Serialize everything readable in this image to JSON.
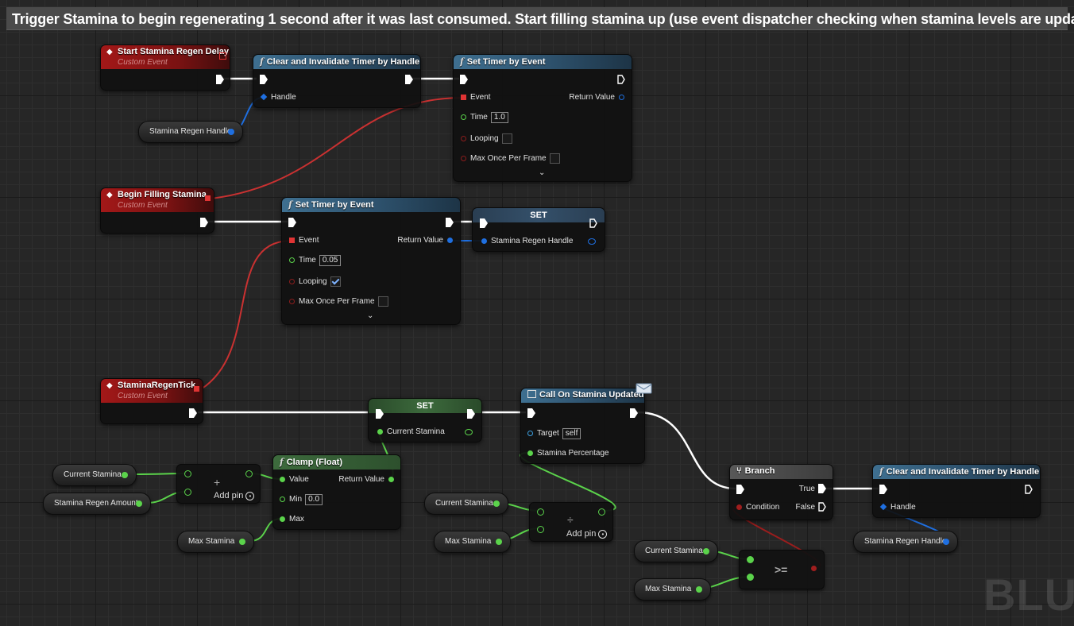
{
  "comment": {
    "title": "Trigger Stamina to begin regenerating 1 second after it was last consumed. Start filling stamina up (use event dispatcher checking when stamina levels are updated)"
  },
  "colors": {
    "exec": "#ffffff",
    "float": "#5bd34b",
    "struct": "#1f6fe0",
    "delegate": "#e03434",
    "bool": "#8b1d1d",
    "event_header": "#a31818",
    "function_header": "#3e6f90"
  },
  "events": {
    "regen_delay": {
      "title": "Start Stamina Regen Delay",
      "subtitle": "Custom Event"
    },
    "begin_filling": {
      "title": "Begin Filling Stamina",
      "subtitle": "Custom Event"
    },
    "regen_tick": {
      "title": "StaminaRegenTick",
      "subtitle": "Custom Event"
    }
  },
  "clear_timer_1": {
    "title": "Clear and Invalidate Timer by Handle",
    "handle_label": "Handle"
  },
  "set_timer_1": {
    "title": "Set Timer by Event",
    "event_label": "Event",
    "return_label": "Return Value",
    "time_label": "Time",
    "time_value": "1.0",
    "looping_label": "Looping",
    "looping_checked": false,
    "max_once_label": "Max Once Per Frame",
    "max_once_checked": false
  },
  "set_timer_2": {
    "title": "Set Timer by Event",
    "event_label": "Event",
    "return_label": "Return Value",
    "time_label": "Time",
    "time_value": "0.05",
    "looping_label": "Looping",
    "looping_checked": true,
    "max_once_label": "Max Once Per Frame",
    "max_once_checked": false
  },
  "set_handle": {
    "title": "SET",
    "pin_label": "Stamina Regen Handle"
  },
  "var_regen_handle_1": {
    "label": "Stamina Regen Handle"
  },
  "set_stamina": {
    "title": "SET",
    "pin_label": "Current Stamina"
  },
  "call_updated": {
    "title": "Call On Stamina Updated",
    "target_label": "Target",
    "target_value": "self",
    "pct_label": "Stamina Percentage"
  },
  "var_current_1": {
    "label": "Current Stamina"
  },
  "var_regen_amount": {
    "label": "Stamina Regen Amount"
  },
  "add_node": {
    "symbol": "+",
    "addpin_label": "Add pin"
  },
  "clamp": {
    "title": "Clamp (Float)",
    "value_label": "Value",
    "return_label": "Return Value",
    "min_label": "Min",
    "min_value": "0.0",
    "max_label": "Max"
  },
  "var_max_1": {
    "label": "Max Stamina"
  },
  "var_current_2": {
    "label": "Current Stamina"
  },
  "var_max_2": {
    "label": "Max Stamina"
  },
  "div_node": {
    "symbol": "÷",
    "addpin_label": "Add pin"
  },
  "branch": {
    "title": "Branch",
    "true_label": "True",
    "false_label": "False",
    "cond_label": "Condition"
  },
  "clear_timer_2": {
    "title": "Clear and Invalidate Timer by Handle",
    "handle_label": "Handle"
  },
  "var_regen_handle_2": {
    "label": "Stamina Regen Handle"
  },
  "var_current_3": {
    "label": "Current Stamina"
  },
  "var_max_3": {
    "label": "Max Stamina"
  },
  "gte_node": {
    "symbol": ">="
  },
  "watermark": "BLU"
}
